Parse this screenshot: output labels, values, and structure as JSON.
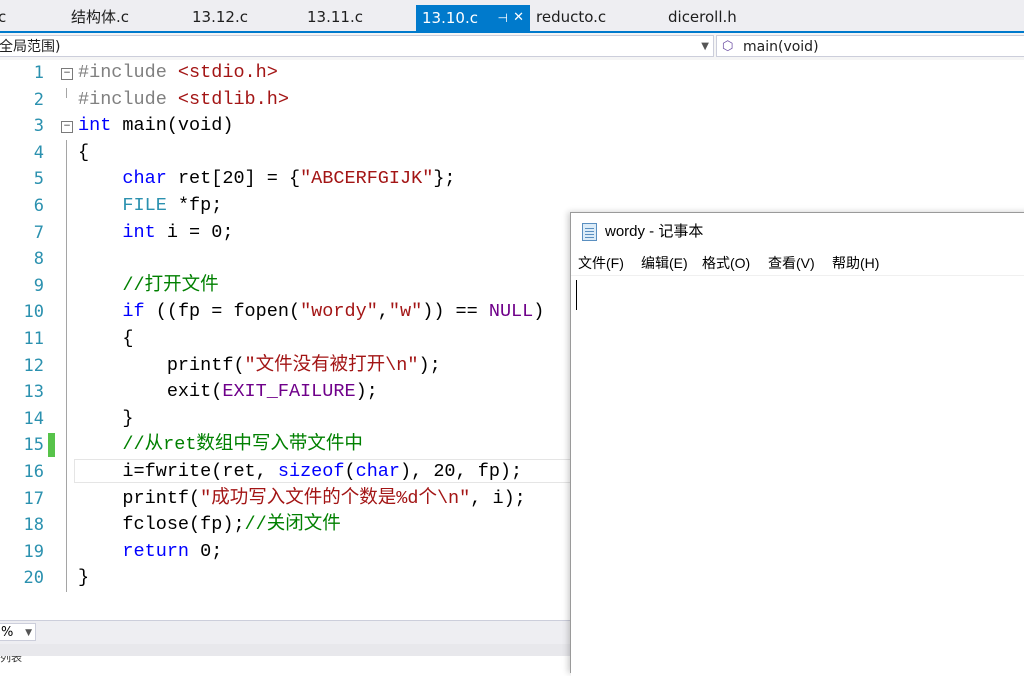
{
  "tabs": [
    {
      "label": "c",
      "active": false
    },
    {
      "label": "结构体.c",
      "active": false
    },
    {
      "label": "13.12.c",
      "active": false
    },
    {
      "label": "13.11.c",
      "active": false
    },
    {
      "label": "13.10.c",
      "active": true
    },
    {
      "label": "reducto.c",
      "active": false
    },
    {
      "label": "diceroll.h",
      "active": false
    }
  ],
  "tab_pin": "⊣",
  "tab_close": "✕",
  "nav": {
    "scope": "全局范围)",
    "function": "main(void)"
  },
  "code": {
    "line_numbers": [
      "1",
      "2",
      "3",
      "4",
      "5",
      "6",
      "7",
      "8",
      "9",
      "10",
      "11",
      "12",
      "13",
      "14",
      "15",
      "16",
      "17",
      "18",
      "19",
      "20"
    ],
    "lines": {
      "l1_kw": "#include",
      "l1_rest": " <stdio.h>",
      "l2_kw": "#include",
      "l2_rest": " <stdlib.h>",
      "l3_kw": "int",
      "l3_rest": " main(void)",
      "l4": "{",
      "l5_kw": "char",
      "l5_a": " ret[20] = {",
      "l5_str": "\"ABCERFGIJK\"",
      "l5_b": "};",
      "l6_typ": "FILE",
      "l6_rest": " *fp;",
      "l7_kw": "int",
      "l7_rest": " i = 0;",
      "l9_cm": "//打开文件",
      "l10_kw": "if",
      "l10_a": " ((fp = fopen(",
      "l10_s1": "\"wordy\"",
      "l10_c": ",",
      "l10_s2": "\"w\"",
      "l10_b": ")) == ",
      "l10_mac": "NULL",
      "l10_e": ")",
      "l11": "{",
      "l12_a": "printf(",
      "l12_str": "\"文件没有被打开\\n\"",
      "l12_b": ");",
      "l13_a": "exit(",
      "l13_mac": "EXIT_FAILURE",
      "l13_b": ");",
      "l14": "}",
      "l15_cm": "//从ret数组中写入带文件中",
      "l16_a": "i=fwrite(ret, ",
      "l16_kw1": "sizeof",
      "l16_b": "(",
      "l16_kw2": "char",
      "l16_c": "), 20, fp);",
      "l17_a": "printf(",
      "l17_str": "\"成功写入文件的个数是%d个\\n\"",
      "l17_b": ", i);",
      "l18_a": "fclose(fp);",
      "l18_cm": "//关闭文件",
      "l19_kw": "return",
      "l19_rest": " 0;",
      "l20": "}"
    }
  },
  "zoom": "%",
  "bottom_text": "列表",
  "notepad": {
    "title": "wordy - 记事本",
    "menu": [
      "文件(F)",
      "编辑(E)",
      "格式(O)",
      "查看(V)",
      "帮助(H)"
    ],
    "content": ""
  },
  "colors": {
    "accent": "#007acc",
    "keyword": "#0000ff",
    "string": "#a31515",
    "comment": "#008000",
    "macro": "#6f008a",
    "line_number": "#2b91af",
    "change_bar": "#57c34a"
  }
}
